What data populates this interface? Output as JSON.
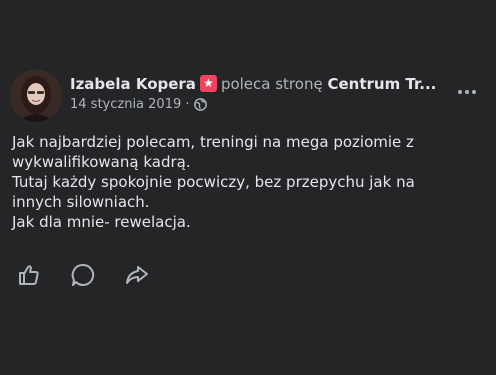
{
  "post": {
    "author": "Izabela Kopera",
    "verb": "poleca stronę",
    "page_name": "Centrum Tr...",
    "date": "14 stycznia 2019 ·",
    "body_lines": [
      "Jak najbardziej polecam, treningi na mega poziomie z",
      "wykwalifikowaną kadrą.",
      "Tutaj każdy spokojnie pocwiczy, bez przepychu jak na",
      "innych silowniach.",
      "Jak dla mnie- rewelacja."
    ]
  },
  "icons": {
    "badge": "recommend-star-icon",
    "privacy": "globe-icon",
    "more": "more-options-icon",
    "like": "thumbs-up-icon",
    "comment": "comment-icon",
    "share": "share-icon"
  },
  "colors": {
    "background": "#242526",
    "text": "#e4e6eb",
    "secondary": "#b0b3b8",
    "badge": "#f3425f"
  }
}
